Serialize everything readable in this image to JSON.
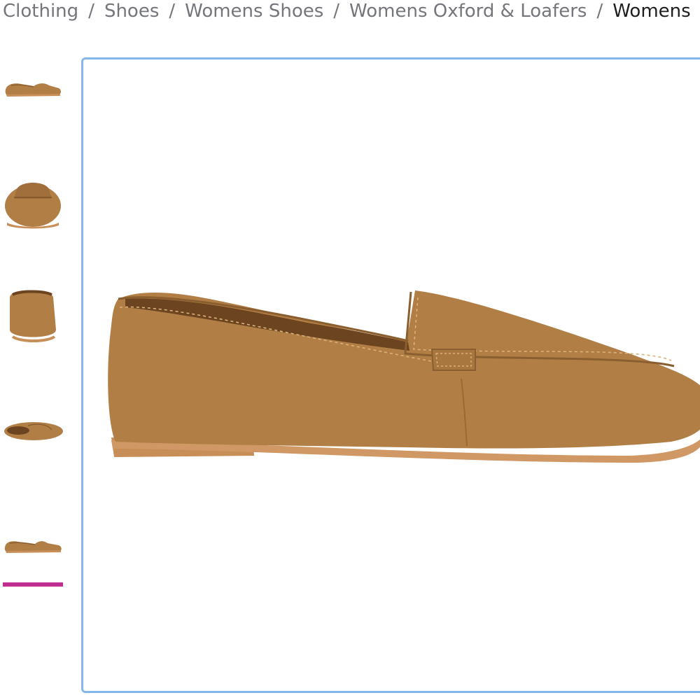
{
  "breadcrumb": {
    "items": [
      {
        "label": "Clothing"
      },
      {
        "label": "Shoes"
      },
      {
        "label": "Womens Shoes"
      },
      {
        "label": "Womens Oxford & Loafers"
      },
      {
        "label": "Womens"
      }
    ],
    "separator": "/"
  },
  "gallery": {
    "thumbnail_count": 5,
    "selected_index": 4,
    "thumbnails": [
      {
        "view": "side"
      },
      {
        "view": "front"
      },
      {
        "view": "back"
      },
      {
        "view": "top"
      },
      {
        "view": "side"
      }
    ]
  },
  "colors": {
    "viewer_border": "#86b7ec",
    "selected_indicator": "#c12e92",
    "shoe_leather": "#b17f46",
    "shoe_sole": "#c98f59",
    "breadcrumb_text": "#74767c",
    "breadcrumb_current": "#1f1f1f"
  }
}
